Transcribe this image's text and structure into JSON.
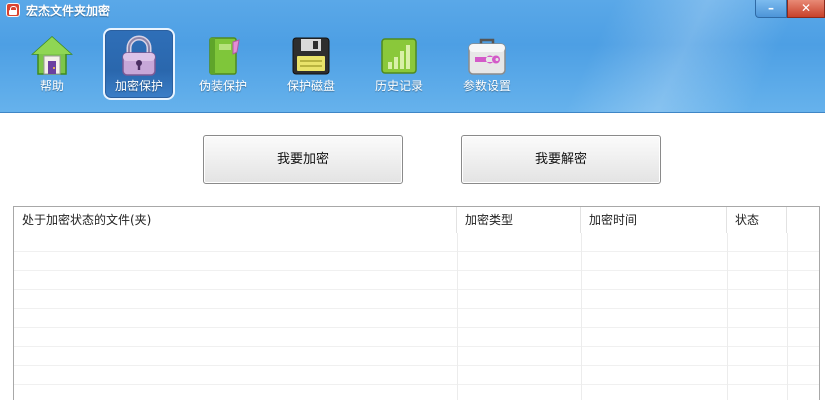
{
  "window": {
    "title": "宏杰文件夹加密",
    "minimize_glyph": "–",
    "close_glyph": "✕"
  },
  "toolbar": {
    "items": [
      {
        "label": "帮助",
        "icon": "home-icon"
      },
      {
        "label": "加密保护",
        "icon": "lock-icon",
        "active": true
      },
      {
        "label": "伪装保护",
        "icon": "notebook-icon"
      },
      {
        "label": "保护磁盘",
        "icon": "floppy-disk-icon"
      },
      {
        "label": "历史记录",
        "icon": "history-chart-icon"
      },
      {
        "label": "参数设置",
        "icon": "toolbox-wrench-icon"
      }
    ]
  },
  "actions": {
    "encrypt_label": "我要加密",
    "decrypt_label": "我要解密"
  },
  "table": {
    "columns": [
      "处于加密状态的文件(夹)",
      "加密类型",
      "加密时间",
      "状态"
    ],
    "rows": []
  },
  "colors": {
    "titlebar": "#4d9fe4",
    "active_tool": "#2a67ad",
    "close_button": "#c8412a"
  }
}
